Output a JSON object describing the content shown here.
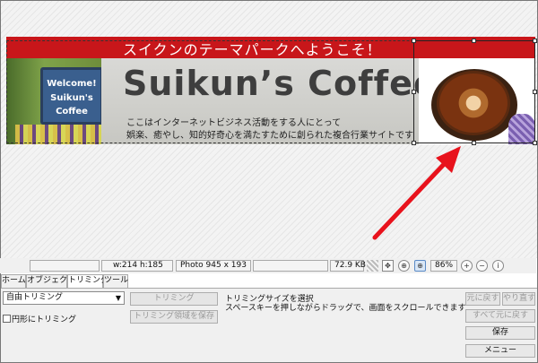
{
  "banner": {
    "top_text": "スイクンのテーマパークへようこそ！",
    "title": "Suikun’s Coffee",
    "description": [
      "ここはインターネットビジネス活動をする人にとって",
      "娯楽、癒やし、知的好奇心を満たすために創られた複合行業サイトです"
    ],
    "sign_lines": [
      "Welcome!",
      "Suikun's",
      "Coffee"
    ]
  },
  "status_bar": {
    "selection_size": "w:214 h:185",
    "photo_size": "Photo 945 x 193",
    "file_size": "72.9 KB",
    "zoom": "86%"
  },
  "tabs": [
    "ホーム",
    "オブジェクト",
    "トリミング",
    "ツール"
  ],
  "active_tab": "トリミング",
  "trim_panel": {
    "mode_select_value": "自由トリミング",
    "circle_trim_label": "円形にトリミング",
    "trim_button": "トリミング",
    "save_area_button": "トリミング領域を保存",
    "hint_line1": "トリミングサイズを選択",
    "hint_line2": "スペースキーを押しながらドラッグで、画面をスクロールできます"
  },
  "right_buttons": {
    "undo": "元に戻す",
    "redo": "やり直す",
    "undo_all": "すべて元に戻す",
    "save": "保存",
    "menu": "メニュー"
  },
  "colors": {
    "banner_red": "#c8161a",
    "arrow_red": "#e8121c"
  }
}
